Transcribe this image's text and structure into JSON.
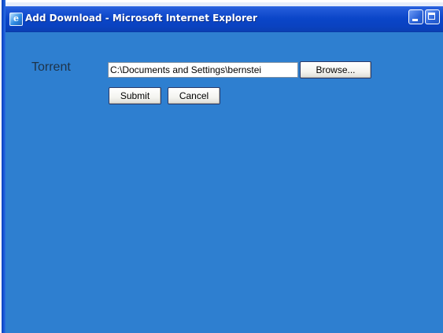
{
  "window": {
    "title": "Add Download - Microsoft Internet Explorer",
    "app_icon": "ie-page-icon",
    "app_icon_glyph": "e",
    "controls": [
      "minimize-icon",
      "maximize-icon"
    ],
    "colors": {
      "titlebar": "#0a45c8",
      "content_background": "#2e7fd0",
      "label_text": "#1e3348"
    }
  },
  "form": {
    "torrent_label": "Torrent",
    "torrent_value": "C:\\Documents and Settings\\bernstei",
    "browse_label": "Browse...",
    "submit_label": "Submit",
    "cancel_label": "Cancel"
  }
}
